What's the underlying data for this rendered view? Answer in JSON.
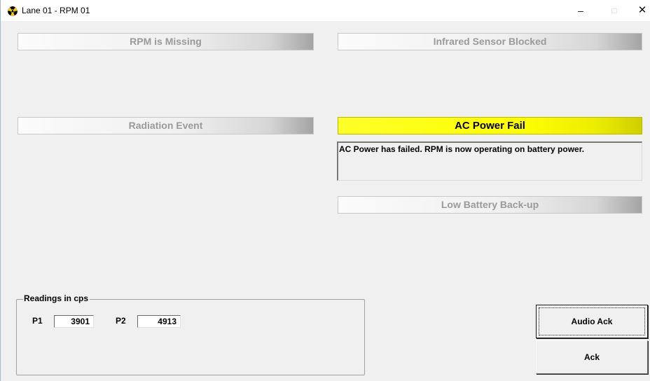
{
  "window": {
    "title": "Lane 01 - RPM 01",
    "controls": {
      "minimize": "–",
      "maximize": "□",
      "close": "✕"
    }
  },
  "status": {
    "rpm_missing": "RPM is Missing",
    "infrared_blocked": "Infrared Sensor Blocked",
    "radiation_event": "Radiation Event",
    "ac_power_fail": "AC Power Fail",
    "low_battery": "Low Battery Back-up"
  },
  "message": {
    "text": "AC Power has failed.  RPM is now operating on battery power."
  },
  "readings": {
    "title": "Readings in cps",
    "p1_label": "P1",
    "p1_value": "3901",
    "p2_label": "P2",
    "p2_value": "4913"
  },
  "buttons": {
    "audio_ack": "Audio Ack",
    "ack": "Ack"
  },
  "colors": {
    "alarm_active": "#ffff00",
    "inactive_text": "#9a9a9a",
    "background": "#f0f0f0"
  }
}
